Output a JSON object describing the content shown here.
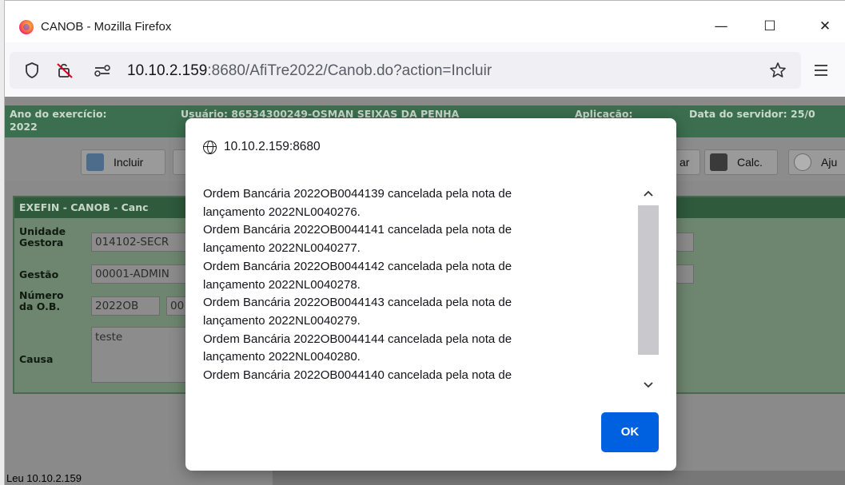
{
  "window": {
    "title": "CANOB - Mozilla Firefox",
    "minimize": "—",
    "maximize": "☐",
    "close": "✕"
  },
  "urlbar": {
    "url_host": "10.10.2.159",
    "url_path": ":8680/AfiTre2022/Canob.do?action=Incluir"
  },
  "app_header": {
    "exercicio": "Ano do exercício:",
    "exercicio_value": "2022",
    "usuario": "Usuário: 86534300249-OSMAN SEIXAS DA PENHA",
    "aplicacao": "Aplicação:",
    "data_servidor": "Data do servidor: 25/0"
  },
  "toolbar": {
    "incluir": "Incluir",
    "partial_left": "",
    "partial_right": "ar",
    "calc": "Calc.",
    "ajuda": "Aju"
  },
  "form": {
    "title": "EXEFIN - CANOB - Canc",
    "unidade_label": "Unidade Gestora",
    "unidade_value": "014102-SECR",
    "gestao_label": "Gestão",
    "gestao_value": "00001-ADMIN",
    "numero_label": "Número da O.B.",
    "numero_prefix": "2022OB",
    "numero_value": "00",
    "causa_label": "Causa",
    "causa_value": "teste"
  },
  "statusbar": {
    "text": "Leu 10.10.2.159"
  },
  "dialog": {
    "origin": "10.10.2.159:8680",
    "lines": [
      "Ordem Bancária 2022OB0044139 cancelada pela nota de",
      "lançamento 2022NL0040276.",
      "Ordem Bancária 2022OB0044141 cancelada pela nota de",
      "lançamento 2022NL0040277.",
      "Ordem Bancária 2022OB0044142 cancelada pela nota de",
      "lançamento 2022NL0040278.",
      "Ordem Bancária 2022OB0044143 cancelada pela nota de",
      "lançamento 2022NL0040279.",
      "Ordem Bancária 2022OB0044144 cancelada pela nota de",
      "lançamento 2022NL0040280.",
      "Ordem Bancária 2022OB0044140 cancelada pela nota de"
    ],
    "ok_label": "OK"
  },
  "colors": {
    "accent": "#0061e0",
    "header_green": "#3c6f4f",
    "form_title_green": "#2f5a3c"
  },
  "icons": {
    "browser": "firefox-logo",
    "shield": "shield-icon",
    "permissions": "permissions-icon",
    "site_info": "site-info-icon",
    "bookmark": "star-icon",
    "menu": "hamburger-icon",
    "origin": "globe-icon"
  }
}
